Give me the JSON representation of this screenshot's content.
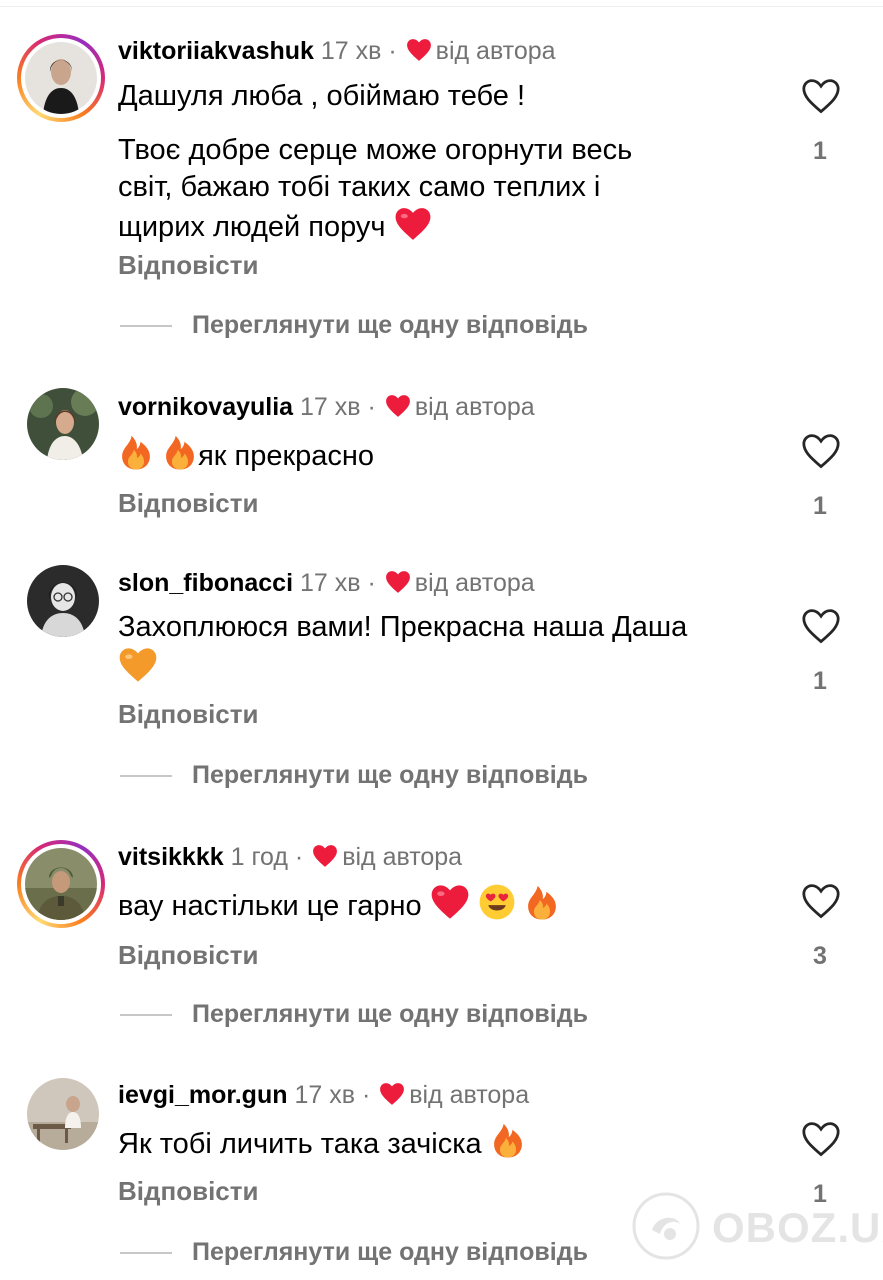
{
  "comments": [
    {
      "username": "viktoriiakvashuk",
      "time": "17 хв",
      "sep": "·",
      "author_liked": "від автора",
      "lines": [
        "Дашуля люба , обіймаю тебе !",
        "Твоє добре серце може огорнути весь",
        "світ, бажаю тобі таких само теплих і",
        "щирих людей поруч"
      ],
      "reply": "Відповісти",
      "likes": "1",
      "more_replies": "Переглянути ще одну відповідь"
    },
    {
      "username": "vornikovayulia",
      "time": "17 хв",
      "sep": "·",
      "author_liked": "від автора",
      "text": "як прекрасно",
      "reply": "Відповісти",
      "likes": "1"
    },
    {
      "username": "slon_fibonacci",
      "time": "17 хв",
      "sep": "·",
      "author_liked": "від автора",
      "text": "Захоплююся вами! Прекрасна наша Даша",
      "reply": "Відповісти",
      "likes": "1",
      "more_replies": "Переглянути ще одну відповідь"
    },
    {
      "username": "vitsikkkk",
      "time": "1 год",
      "sep": "·",
      "author_liked": "від автора",
      "text": "вау настільки це гарно",
      "reply": "Відповісти",
      "likes": "3",
      "more_replies": "Переглянути ще одну відповідь"
    },
    {
      "username": "ievgi_mor.gun",
      "time": "17 хв",
      "sep": "·",
      "author_liked": "від автора",
      "text": "Як тобі личить така зачіска",
      "reply": "Відповісти",
      "likes": "1",
      "more_replies": "Переглянути ще одну відповідь"
    }
  ],
  "watermark": "OBOZ.UA",
  "colors": {
    "heart_red": "#ed1c3d",
    "secondary_text": "#737373",
    "fire_orange": "#f7931e",
    "heart_orange": "#f39a2b"
  },
  "icons": [
    "heart-outline-icon",
    "red-heart-icon",
    "fire-emoji-icon",
    "orange-heart-icon",
    "heart-eyes-emoji-icon"
  ]
}
